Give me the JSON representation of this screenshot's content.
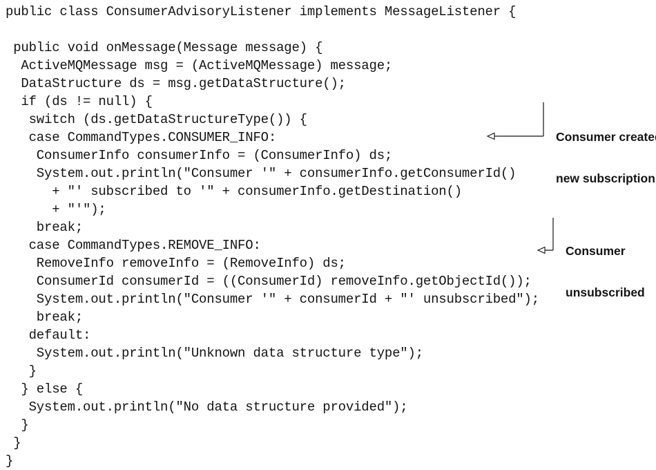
{
  "code_lines": [
    "public class ConsumerAdvisoryListener implements MessageListener {",
    "",
    " public void onMessage(Message message) {",
    "  ActiveMQMessage msg = (ActiveMQMessage) message;",
    "  DataStructure ds = msg.getDataStructure();",
    "  if (ds != null) {",
    "   switch (ds.getDataStructureType()) {",
    "   case CommandTypes.CONSUMER_INFO:",
    "    ConsumerInfo consumerInfo = (ConsumerInfo) ds;",
    "    System.out.println(\"Consumer '\" + consumerInfo.getConsumerId()",
    "      + \"' subscribed to '\" + consumerInfo.getDestination()",
    "      + \"'\");",
    "    break;",
    "   case CommandTypes.REMOVE_INFO:",
    "    RemoveInfo removeInfo = (RemoveInfo) ds;",
    "    ConsumerId consumerId = ((ConsumerId) removeInfo.getObjectId());",
    "    System.out.println(\"Consumer '\" + consumerId + \"' unsubscribed\");",
    "    break;",
    "   default:",
    "    System.out.println(\"Unknown data structure type\");",
    "   }",
    "  } else {",
    "   System.out.println(\"No data structure provided\");",
    "  }",
    " }",
    "}"
  ],
  "annotations": [
    {
      "line1": "Consumer created",
      "line2": "new subscription"
    },
    {
      "line1": "Consumer",
      "line2": "unsubscribed"
    }
  ]
}
